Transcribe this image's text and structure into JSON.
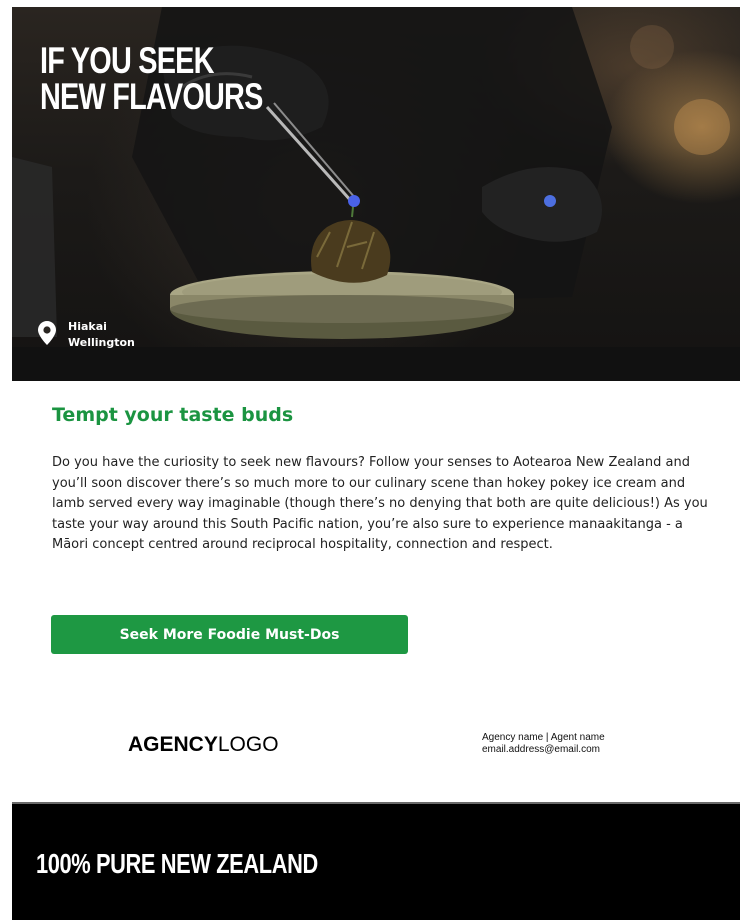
{
  "hero": {
    "title_line1": "IF YOU SEEK",
    "title_line2": "NEW FLAVOURS",
    "location_name": "Hiakai",
    "location_city": "Wellington"
  },
  "content": {
    "heading": "Tempt your taste buds",
    "paragraph": "Do you have the curiosity to seek new flavours? Follow your senses to Aotearoa New Zealand and you’ll soon discover there’s so much more to our culinary scene than hokey pokey ice cream and lamb served every way imaginable (though there’s no denying that both are quite delicious!) As you taste your way around this South Pacific nation, you’re also sure to experience manaakitanga - a Māori concept centred around reciprocal hospitality, connection and respect.",
    "cta_label": "Seek More Foodie Must-Dos"
  },
  "agency": {
    "logo_bold": "AGENCY",
    "logo_light": "LOGO",
    "contact_line1": "Agency name  |  Agent name",
    "contact_line2": "email.address@email.com"
  },
  "banner": {
    "text": "100% PURE NEW ZEALAND"
  },
  "colors": {
    "accent_green": "#1b9441",
    "button_green": "#1e9843",
    "banner_black": "#000000"
  },
  "icons": {
    "location": "map-pin-icon"
  }
}
